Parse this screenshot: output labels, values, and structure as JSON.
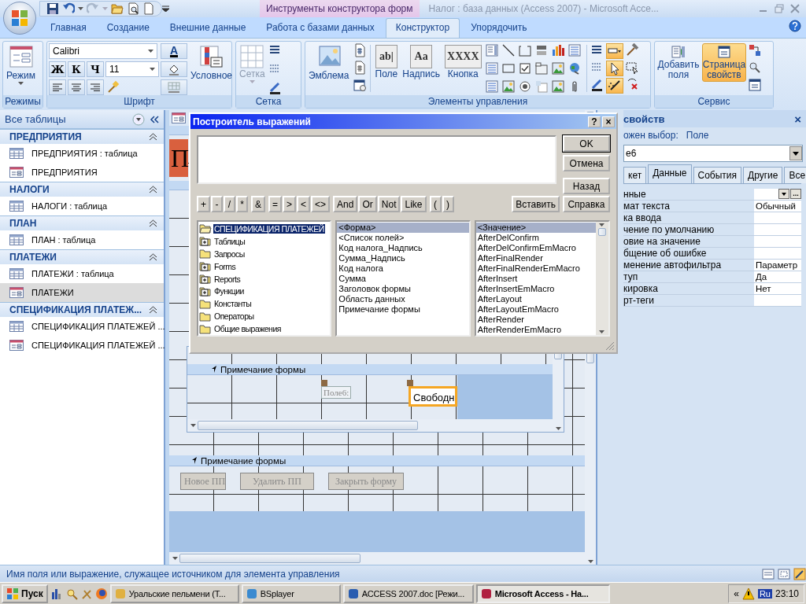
{
  "window": {
    "title": "Налог : база данных (Access 2007) - Microsoft Acce...",
    "context_label": "Инструменты конструктора форм"
  },
  "ribbon_tabs": [
    {
      "label": "Главная",
      "selected": false
    },
    {
      "label": "Создание",
      "selected": false
    },
    {
      "label": "Внешние данные",
      "selected": false
    },
    {
      "label": "Работа с базами данных",
      "selected": false
    },
    {
      "label": "Конструктор",
      "selected": true
    },
    {
      "label": "Упорядочить",
      "selected": false
    }
  ],
  "ribbon": {
    "views": {
      "title": "Режимы",
      "button": "Режим"
    },
    "font": {
      "title": "Шрифт",
      "font_name": "Calibri",
      "font_size": "11",
      "style_buttons": [
        "Ж",
        "К",
        "Ч"
      ],
      "color_button": "A",
      "conditional": "Условное"
    },
    "grid": {
      "title": "Сетка",
      "button": "Сетка",
      "disabled": true
    },
    "controls": {
      "title": "Элементы управления",
      "buttons": [
        {
          "label": "Эмблема",
          "kind": "picture"
        },
        {
          "label": "Поле",
          "kind": "text",
          "icon_text": "ab|"
        },
        {
          "label": "Надпись",
          "kind": "text",
          "icon_text": "Aa"
        },
        {
          "label": "Кнопка",
          "kind": "text",
          "icon_text": "XXXX"
        }
      ],
      "mode_tools": [
        {
          "kind": "rectangle",
          "selected": true
        },
        {
          "kind": "pointer",
          "selected": true
        },
        {
          "kind": "wand",
          "selected": true
        }
      ]
    },
    "tools": {
      "title": "Сервис",
      "buttons": [
        {
          "label": "Добавить поля",
          "selected": false
        },
        {
          "label": "Страница свойств",
          "selected": true
        }
      ]
    }
  },
  "navigation": {
    "title": "Все таблицы",
    "groups": [
      {
        "title": "ПРЕДПРИЯТИЯ",
        "expanded": true,
        "items": [
          {
            "label": "ПРЕДПРИЯТИЯ : таблица",
            "kind": "table",
            "selected": false
          },
          {
            "label": "ПРЕДПРИЯТИЯ",
            "kind": "form",
            "selected": false
          }
        ]
      },
      {
        "title": "НАЛОГИ",
        "expanded": true,
        "items": [
          {
            "label": "НАЛОГИ : таблица",
            "kind": "table",
            "selected": false
          }
        ]
      },
      {
        "title": "ПЛАН",
        "expanded": true,
        "items": [
          {
            "label": "ПЛАН : таблица",
            "kind": "table",
            "selected": false
          }
        ]
      },
      {
        "title": "ПЛАТЕЖИ",
        "expanded": true,
        "items": [
          {
            "label": "ПЛАТЕЖИ : таблица",
            "kind": "table",
            "selected": false
          },
          {
            "label": "ПЛАТЕЖИ",
            "kind": "form",
            "selected": true
          }
        ]
      },
      {
        "title": "СПЕЦИФИКАЦИЯ ПЛАТЕЖ...",
        "expanded": true,
        "items": [
          {
            "label": "СПЕЦИФИКАЦИЯ ПЛАТЕЖЕЙ ...",
            "kind": "table",
            "selected": false
          },
          {
            "label": "СПЕЦИФИКАЦИЯ ПЛАТЕЖЕЙ ...",
            "kind": "form",
            "selected": false
          }
        ]
      }
    ]
  },
  "designer": {
    "title_label": "П",
    "subform": {
      "section": "Примечание формы",
      "field_label": "Поле6:",
      "field": "Свободн",
      "field_selected": true
    },
    "footer_section": "Примечание формы",
    "buttons": [
      "Новое ПП",
      "Удалить ПП",
      "Закрыть форму"
    ]
  },
  "expression_builder": {
    "title": "Построитель выражений",
    "help": "?",
    "close": "×",
    "buttons": [
      "OK",
      "Отмена",
      "Назад",
      "Справка"
    ],
    "paste": "Вставить",
    "operator_groups": [
      [
        "+",
        "-",
        "/",
        "*"
      ],
      [
        "&"
      ],
      [
        "=",
        ">",
        "<",
        "<>"
      ],
      [
        "And",
        "Or",
        "Not",
        "Like"
      ],
      [
        "(",
        ")"
      ]
    ],
    "tree": [
      {
        "label": "СПЕЦИФИКАЦИЯ ПЛАТЕЖЕЙ",
        "kind": "open",
        "selected": true
      },
      {
        "label": "Таблицы",
        "kind": "expandable",
        "selected": false
      },
      {
        "label": "Запросы",
        "kind": "folder",
        "selected": false
      },
      {
        "label": "Forms",
        "kind": "expandable",
        "selected": false
      },
      {
        "label": "Reports",
        "kind": "expandable",
        "selected": false
      },
      {
        "label": "Функции",
        "kind": "expandable",
        "selected": false
      },
      {
        "label": "Константы",
        "kind": "folder",
        "selected": false
      },
      {
        "label": "Операторы",
        "kind": "folder",
        "selected": false
      },
      {
        "label": "Общие выражения",
        "kind": "folder",
        "selected": false
      }
    ],
    "members": [
      {
        "label": "<Форма>",
        "selected": true
      },
      {
        "label": "<Список полей>",
        "selected": false
      },
      {
        "label": "Код налога_Надпись",
        "selected": false
      },
      {
        "label": "Сумма_Надпись",
        "selected": false
      },
      {
        "label": "Код налога",
        "selected": false
      },
      {
        "label": "Сумма",
        "selected": false
      },
      {
        "label": "Заголовок формы",
        "selected": false
      },
      {
        "label": "Область данных",
        "selected": false
      },
      {
        "label": "Примечание формы",
        "selected": false
      }
    ],
    "values": [
      {
        "label": "<Значение>",
        "selected": true
      },
      {
        "label": "AfterDelConfirm",
        "selected": false
      },
      {
        "label": "AfterDelConfirmEmMacro",
        "selected": false
      },
      {
        "label": "AfterFinalRender",
        "selected": false
      },
      {
        "label": "AfterFinalRenderEmMacro",
        "selected": false
      },
      {
        "label": "AfterInsert",
        "selected": false
      },
      {
        "label": "AfterInsertEmMacro",
        "selected": false
      },
      {
        "label": "AfterLayout",
        "selected": false
      },
      {
        "label": "AfterLayoutEmMacro",
        "selected": false
      },
      {
        "label": "AfterRender",
        "selected": false
      },
      {
        "label": "AfterRenderEmMacro",
        "selected": false
      }
    ]
  },
  "property_sheet": {
    "title": "свойств",
    "close": "×",
    "selection_label": "ожен выбор:",
    "selection_type": "Поле",
    "control": "е6",
    "tabs": [
      {
        "label": "кет",
        "selected": false
      },
      {
        "label": "Данные",
        "selected": true
      },
      {
        "label": "События",
        "selected": false
      },
      {
        "label": "Другие",
        "selected": false
      },
      {
        "label": "Все",
        "selected": false
      }
    ],
    "rows": [
      {
        "label": "нные",
        "kind": "builder",
        "builder_button": "..."
      },
      {
        "label": "мат текста",
        "kind": "text",
        "value": "Обычный"
      },
      {
        "label": "ка ввода",
        "kind": "text"
      },
      {
        "label": "чение по умолчанию",
        "kind": "text"
      },
      {
        "label": "овие на значение",
        "kind": "text"
      },
      {
        "label": "бщение об ошибке",
        "kind": "text"
      },
      {
        "label": "менение автофильтра",
        "kind": "text",
        "value": "Параметр"
      },
      {
        "label": "туп",
        "kind": "text",
        "value": "Да"
      },
      {
        "label": "кировка",
        "kind": "text",
        "value": "Нет"
      },
      {
        "label": "рт-теги",
        "kind": "text"
      }
    ]
  },
  "status_bar": {
    "text": "Имя поля или выражение, служащее источником для элемента управления"
  },
  "taskbar": {
    "start": "Пуск",
    "tasks": [
      {
        "label": "Уральские пельмени (Т...",
        "selected": false
      },
      {
        "label": "BSplayer",
        "selected": false
      },
      {
        "label": "ACCESS 2007.doc [Режи...",
        "selected": false
      },
      {
        "label": "Microsoft Access - На...",
        "selected": true
      }
    ],
    "tray_toggle": "«",
    "language": "Ru",
    "clock": "23:10"
  }
}
